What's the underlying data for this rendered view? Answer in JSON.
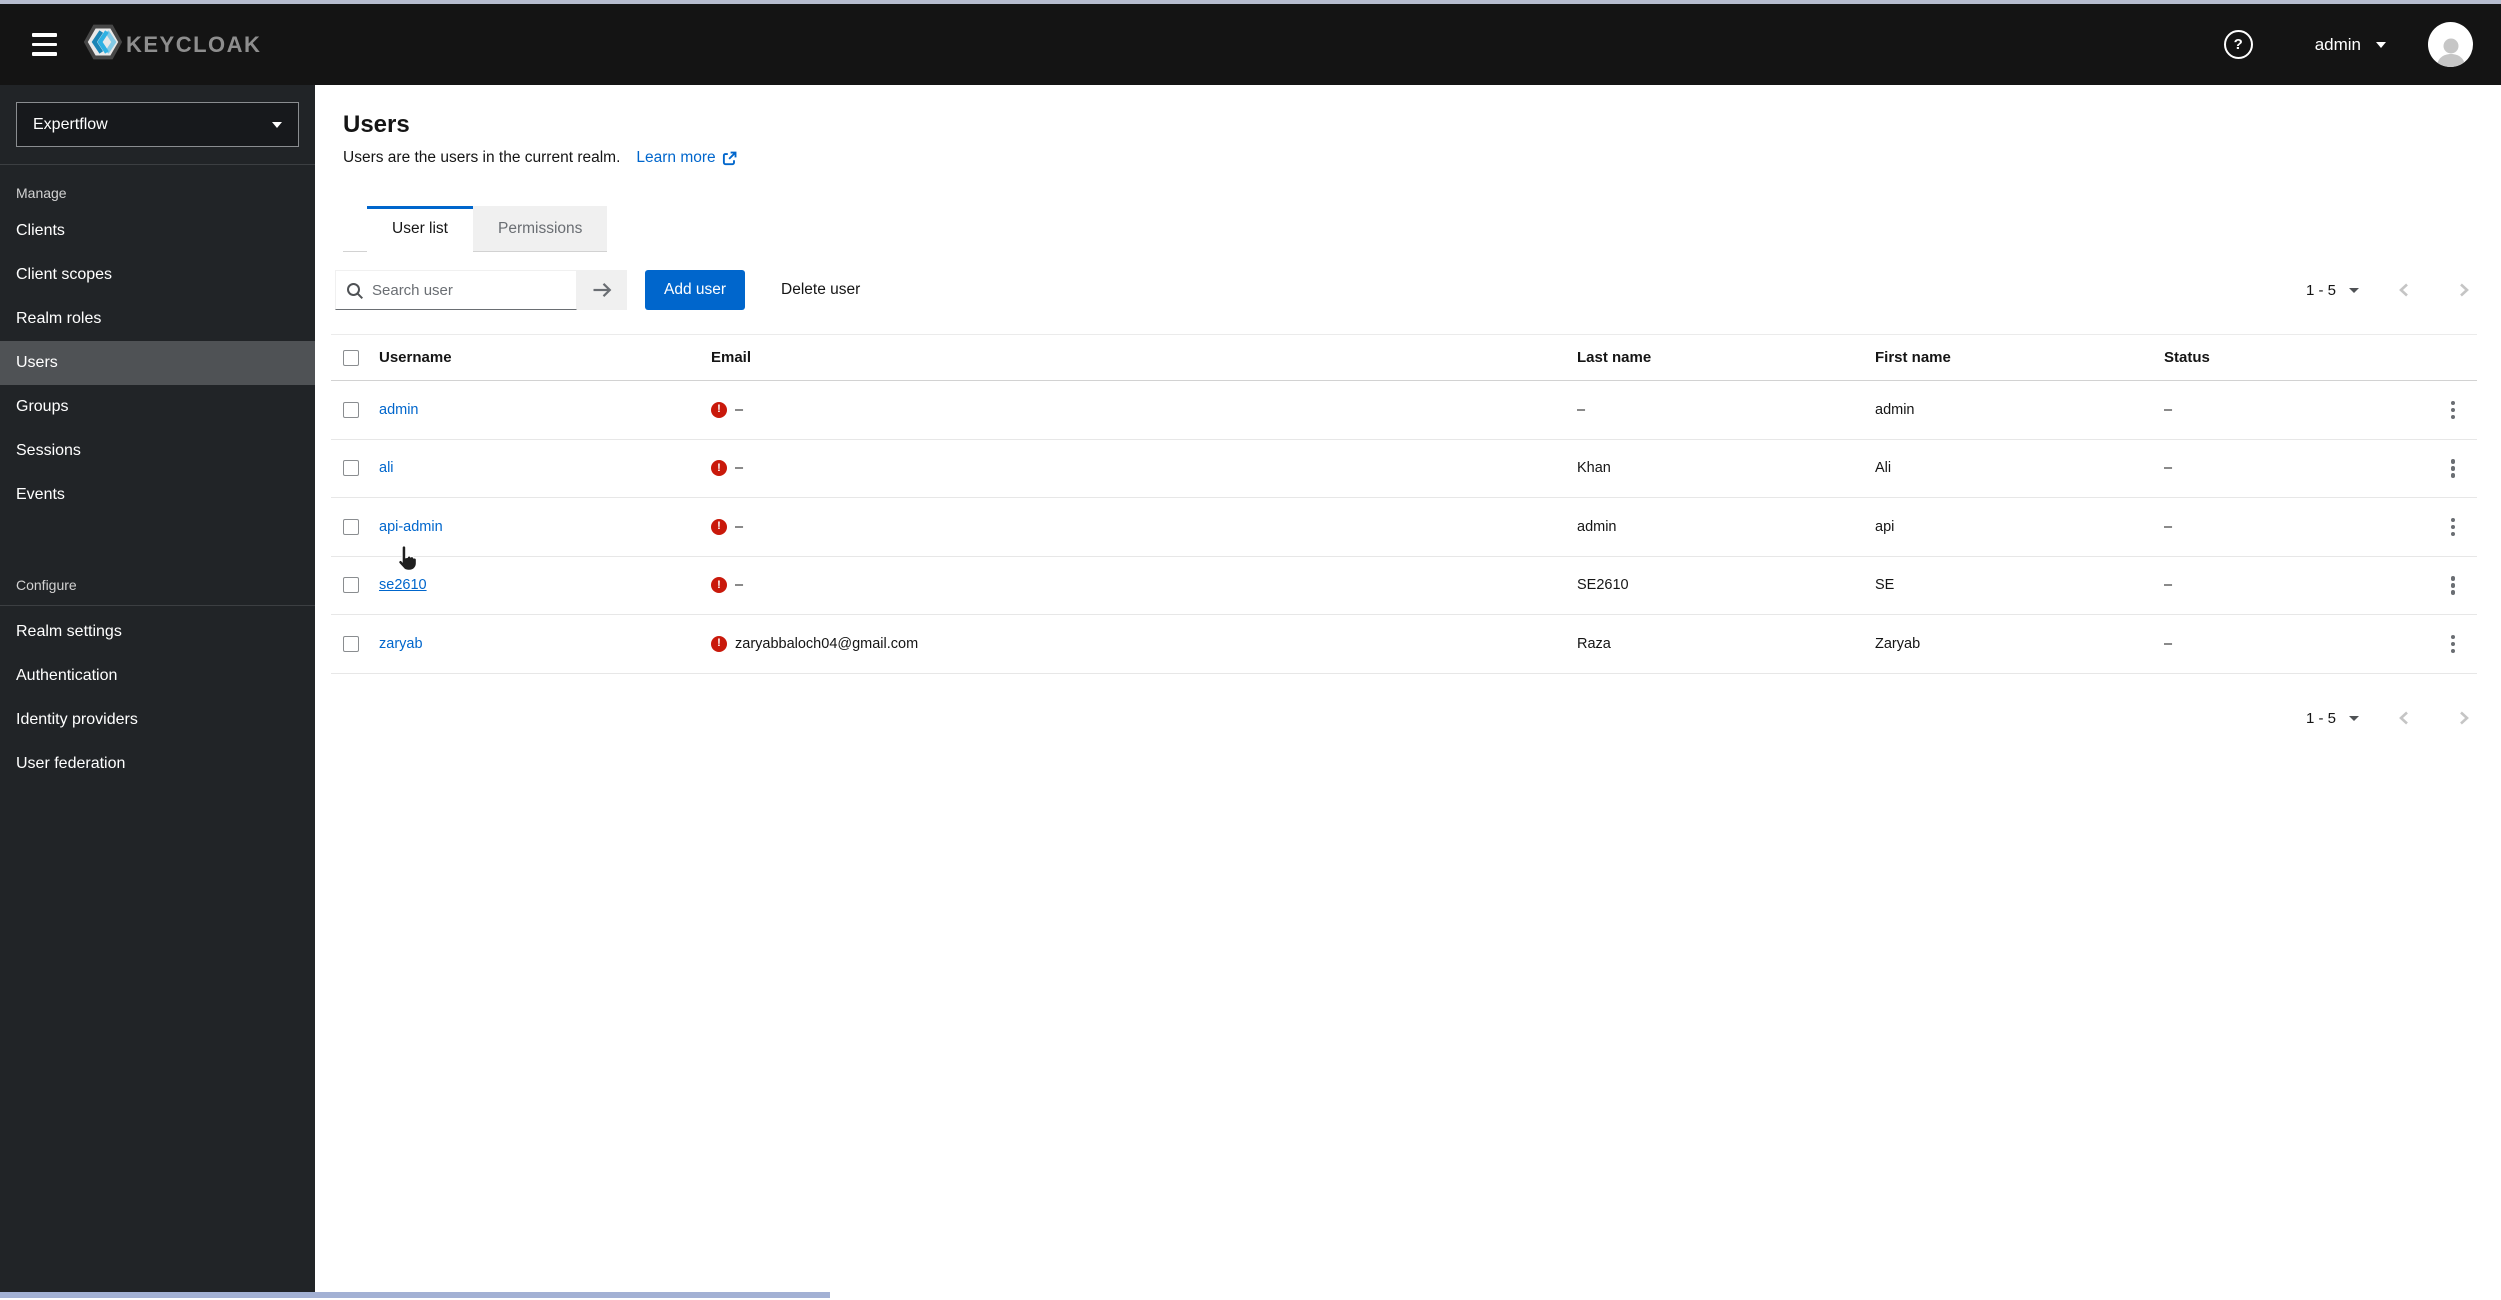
{
  "masthead": {
    "brand": "KEYCLOAK",
    "user": {
      "name": "admin"
    }
  },
  "sidebar": {
    "realm_selector": {
      "value": "Expertflow"
    },
    "active_item": "Users",
    "sections": [
      {
        "label": "Manage",
        "items": [
          "Clients",
          "Client scopes",
          "Realm roles",
          "Users",
          "Groups",
          "Sessions",
          "Events"
        ]
      },
      {
        "label": "Configure",
        "items": [
          "Realm settings",
          "Authentication",
          "Identity providers",
          "User federation"
        ]
      }
    ]
  },
  "page": {
    "title": "Users",
    "description": "Users are the users in the current realm.",
    "learn_more_label": "Learn more",
    "tabs": [
      {
        "label": "User list",
        "active": true
      },
      {
        "label": "Permissions",
        "active": false
      }
    ]
  },
  "toolbar": {
    "search_placeholder": "Search user",
    "search_value": "",
    "add_user_label": "Add user",
    "delete_user_label": "Delete user",
    "pagination_range": "1 - 5"
  },
  "table": {
    "columns": [
      "Username",
      "Email",
      "Last name",
      "First name",
      "Status"
    ],
    "empty_value": "–",
    "rows": [
      {
        "username": "admin",
        "email": "–",
        "email_warning": true,
        "last_name": "–",
        "first_name": "admin",
        "status": "–"
      },
      {
        "username": "ali",
        "email": "–",
        "email_warning": true,
        "last_name": "Khan",
        "first_name": "Ali",
        "status": "–"
      },
      {
        "username": "api-admin",
        "email": "–",
        "email_warning": true,
        "last_name": "admin",
        "first_name": "api",
        "status": "–"
      },
      {
        "username": "se2610",
        "email": "–",
        "email_warning": true,
        "last_name": "SE2610",
        "first_name": "SE",
        "status": "–"
      },
      {
        "username": "zaryab",
        "email": "zaryabbaloch04@gmail.com",
        "email_warning": true,
        "last_name": "Raza",
        "first_name": "Zaryab",
        "status": "–"
      }
    ]
  },
  "icons": {
    "nav_toggle": "hamburger",
    "help": "question-circle",
    "user_caret": "caret-down",
    "search": "magnifier",
    "search_submit": "arrow-right",
    "external_link": "external-link",
    "email_warning": "exclamation-circle",
    "row_actions": "kebab-vertical",
    "pagination_prev": "chevron-left",
    "pagination_next": "chevron-right"
  },
  "colors": {
    "primary_blue": "#0066cc",
    "danger_red": "#c9190b",
    "masthead_bg": "#141414",
    "sidebar_bg": "#212427",
    "sidebar_active_bg": "#4f5255",
    "brand_gray": "#8e8e8e"
  }
}
